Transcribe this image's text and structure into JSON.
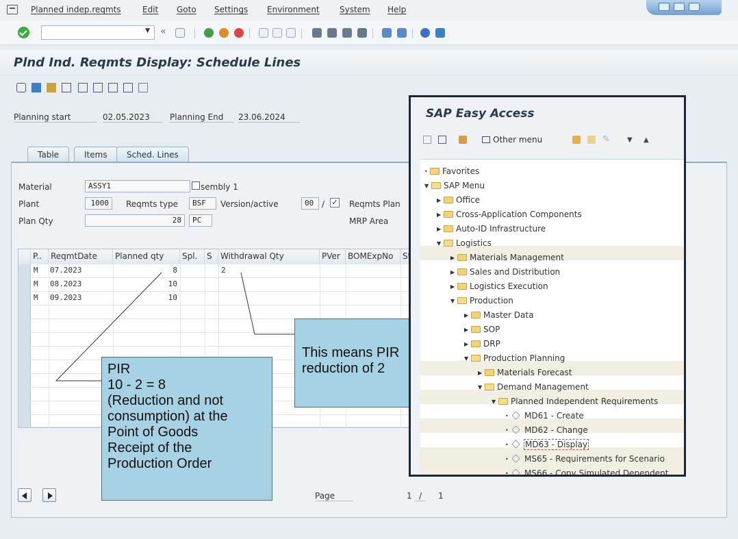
{
  "menu": {
    "items": [
      "Planned indep.reqmts",
      "Edit",
      "Goto",
      "Settings",
      "Environment",
      "System",
      "Help"
    ]
  },
  "toolbar": {
    "command_value": "",
    "back_label": "«"
  },
  "title": "Plnd Ind. Reqmts Display: Schedule Lines",
  "header": {
    "planning_start_label": "Planning start",
    "planning_start": "02.05.2023",
    "planning_end_label": "Planning End",
    "planning_end": "23.06.2024"
  },
  "tabs": [
    "Table",
    "Items",
    "Sched. Lines"
  ],
  "fields": {
    "material_label": "Material",
    "material": "ASSY1",
    "material_desc": "sembly 1",
    "plant_label": "Plant",
    "plant": "1000",
    "reqmts_type_label": "Reqmts type",
    "reqmts_type": "BSF",
    "version_label": "Version/active",
    "version": "00",
    "version_sep": "/",
    "reqmts_plan_label": "Reqmts Plan",
    "plan_qty_label": "Plan Qty",
    "plan_qty": "28",
    "uom": "PC",
    "mrp_area_label": "MRP Area"
  },
  "table": {
    "headers": [
      "P..",
      "ReqmtDate",
      "Planned qty",
      "Spl.",
      "S",
      "Withdrawal Qty",
      "PVer",
      "BOMExpNo",
      "St"
    ],
    "rows": [
      [
        "M",
        "07.2023",
        "8",
        "",
        "",
        "2"
      ],
      [
        "M",
        "08.2023",
        "10",
        "",
        "",
        ""
      ],
      [
        "M",
        "09.2023",
        "10",
        "",
        "",
        ""
      ]
    ]
  },
  "paging": {
    "label": "Page",
    "current": "1",
    "sep": "/",
    "total": "1"
  },
  "callouts": {
    "pir": [
      "PIR",
      "10 - 2 = 8",
      "(Reduction and not",
      "consumption) at the",
      "Point of Goods",
      "Receipt of the",
      "Production Order"
    ],
    "reduction": [
      "This means PIR",
      "reduction of 2"
    ]
  },
  "easy_access": {
    "title": "SAP Easy Access",
    "other_menu": "Other menu",
    "tree": [
      "Favorites",
      "SAP Menu",
      "Office",
      "Cross-Application Components",
      "Auto-ID Infrastructure",
      "Logistics",
      "Materials Management",
      "Sales and Distribution",
      "Logistics Execution",
      "Production",
      "Master Data",
      "SOP",
      "DRP",
      "Production Planning",
      "Materials Forecast",
      "Demand Management",
      "Planned Independent Requirements",
      "MD61 - Create",
      "MD62 - Change",
      "MD63 - Display",
      "MS65 - Requirements for Scenario",
      "MS66 - Copy Simulated Dependent"
    ]
  },
  "colors": {
    "callout_fill": "#a7d2e4",
    "panel_border": "#1b2540",
    "folder": "#f4d27a",
    "ok_green": "#3cad3c"
  }
}
